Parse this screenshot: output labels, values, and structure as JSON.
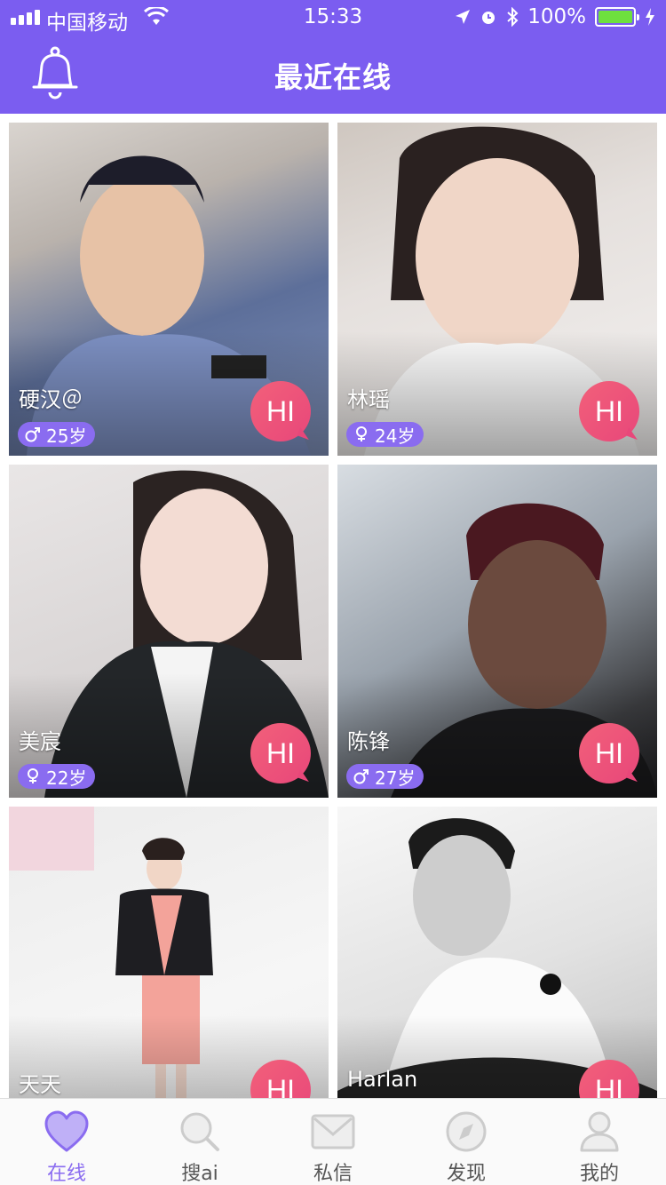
{
  "status_bar": {
    "carrier": "中国移动",
    "time": "15:33",
    "battery": "100%"
  },
  "header": {
    "title": "最近在线",
    "bell_icon": "bell-icon"
  },
  "colors": {
    "accent": "#7b5df0",
    "badge": "#8a6cf0",
    "hi": "#ee5678",
    "battery": "#6ee03e"
  },
  "users": [
    {
      "name": "硬汉＠",
      "gender": "male",
      "age_label": "25岁",
      "hi_label": "HI"
    },
    {
      "name": "林瑶",
      "gender": "female",
      "age_label": "24岁",
      "hi_label": "HI"
    },
    {
      "name": "美宸",
      "gender": "female",
      "age_label": "22岁",
      "hi_label": "HI"
    },
    {
      "name": "陈锋",
      "gender": "male",
      "age_label": "27岁",
      "hi_label": "HI"
    },
    {
      "name": "天天",
      "gender": "female",
      "age_label": "",
      "hi_label": "HI"
    },
    {
      "name": "Harlan",
      "gender": "male",
      "age_label": "",
      "hi_label": "HI"
    }
  ],
  "tabs": [
    {
      "label": "在线",
      "icon": "heart-icon",
      "active": true
    },
    {
      "label": "搜ai",
      "icon": "search-icon",
      "active": false
    },
    {
      "label": "私信",
      "icon": "mail-icon",
      "active": false
    },
    {
      "label": "发现",
      "icon": "compass-icon",
      "active": false
    },
    {
      "label": "我的",
      "icon": "person-icon",
      "active": false
    }
  ]
}
